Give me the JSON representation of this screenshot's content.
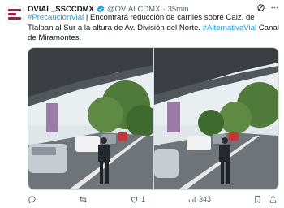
{
  "tweet": {
    "display_name": "OVIAL_SSCCDMX",
    "handle": "@OVIALCDMX",
    "separator": "·",
    "time": "35min",
    "text_parts": [
      {
        "kind": "tag",
        "text": "#PrecauciónVial"
      },
      {
        "kind": "text",
        "text": " | Encontrará reducción de carriles sobre Calz. de Tlalpan al Sur a la altura de Av. División del Norte. "
      },
      {
        "kind": "tag",
        "text": "#AlternativaVial"
      },
      {
        "kind": "text",
        "text": " Canal de Miramontes."
      }
    ]
  },
  "actions": {
    "likes": "1",
    "views": "343"
  },
  "icons": {
    "verified": "verified-badge-icon",
    "grok": "grok-icon",
    "more": "more-icon",
    "reply": "reply-icon",
    "retweet": "retweet-icon",
    "like": "heart-icon",
    "views": "views-icon",
    "bookmark": "bookmark-icon",
    "share": "share-icon"
  },
  "colors": {
    "link": "#1d9bf0",
    "verified": "#1d9bf0",
    "secondary_text": "#536471",
    "brand_avatar": "#b0183d"
  }
}
